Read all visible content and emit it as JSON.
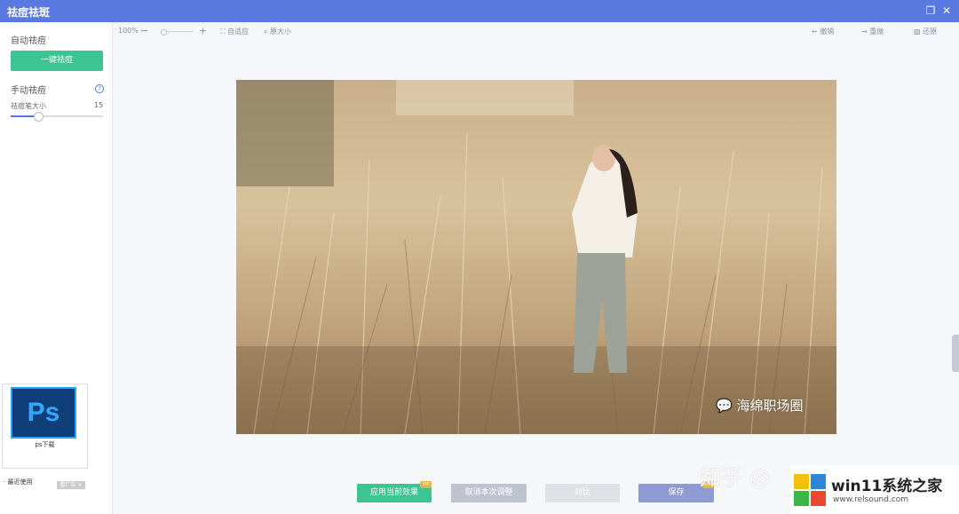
{
  "window": {
    "title": "祛痘祛斑"
  },
  "sidebar": {
    "auto_label": "自动祛痘",
    "one_click_button": "一键祛痘",
    "manual_label": "手动祛痘",
    "help_icon": "?",
    "brush_label": "祛痘笔大小",
    "brush_value": "15",
    "brush_fraction": 0.3
  },
  "toolbar": {
    "zoom": "100%",
    "minus": "−",
    "plus": "+",
    "zoom_fraction": 0.05,
    "fit": "自适应",
    "original": "原大小",
    "undo": "撤销",
    "redo": "重做",
    "restore": "还原"
  },
  "ad": {
    "logo_text": "Ps",
    "caption": "ps下载",
    "recent": "· 最近使用",
    "tag": "看广告 ✕"
  },
  "photo": {
    "watermark": "海绵职场圈"
  },
  "bottom": {
    "apply": "应用当前效果",
    "cancel": "取消本次调整",
    "compare": "对比",
    "save": "保存",
    "vip": "VIP"
  },
  "overlay": {
    "zhihu": "知乎 @",
    "site_name": "win11系统之家",
    "site_url": "www.relsound.com"
  },
  "colors": {
    "accent": "#5a79e0",
    "green": "#3cc592"
  }
}
